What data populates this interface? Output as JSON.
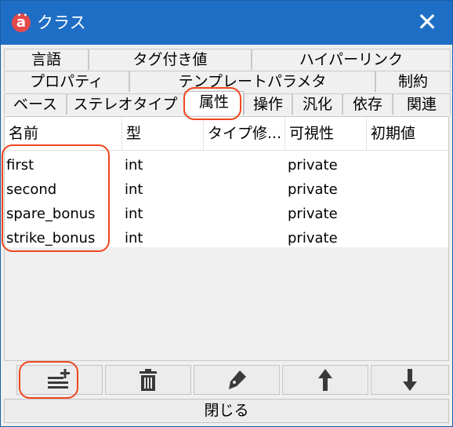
{
  "window": {
    "title": "クラス",
    "close_symbol": "✕",
    "app_icon_letter": "a"
  },
  "tabs": {
    "row1": [
      "言語",
      "タグ付き値",
      "ハイパーリンク"
    ],
    "row2": [
      "プロパティ",
      "テンプレートパラメタ",
      "制約"
    ],
    "row3": [
      "ベース",
      "ステレオタイプ",
      "属性",
      "操作",
      "汎化",
      "依存",
      "関連"
    ],
    "active": "属性"
  },
  "table": {
    "columns": [
      "名前",
      "型",
      "タイプ修...",
      "可視性",
      "初期値"
    ],
    "rows": [
      {
        "name": "first",
        "type": "int",
        "modifier": "",
        "visibility": "private",
        "initial": ""
      },
      {
        "name": "second",
        "type": "int",
        "modifier": "",
        "visibility": "private",
        "initial": ""
      },
      {
        "name": "spare_bonus",
        "type": "int",
        "modifier": "",
        "visibility": "private",
        "initial": ""
      },
      {
        "name": "strike_bonus",
        "type": "int",
        "modifier": "",
        "visibility": "private",
        "initial": ""
      }
    ]
  },
  "toolbar": {
    "buttons": [
      "add-icon",
      "trash-icon",
      "pen-icon",
      "arrow-up-icon",
      "arrow-down-icon"
    ]
  },
  "footer": {
    "close_label": "閉じる"
  },
  "colors": {
    "titlebar": "#1f6ec5",
    "annotation": "#f0461e"
  }
}
